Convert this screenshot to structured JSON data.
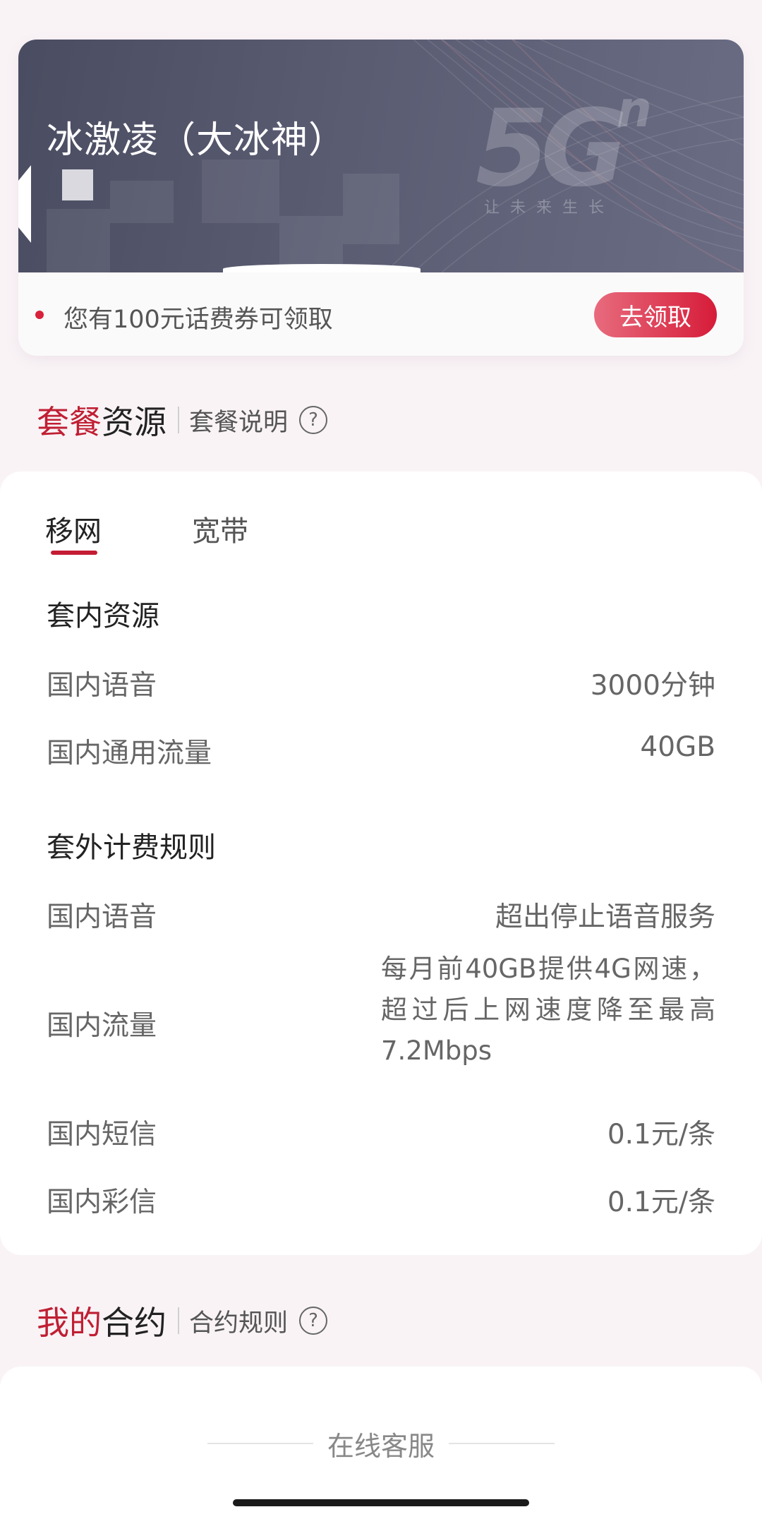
{
  "banner": {
    "user_name": "冰激凌（大冰神）",
    "logo_text": "5G",
    "logo_superscript": "n",
    "logo_slogan": "让未来生长"
  },
  "coupon": {
    "text": "您有100元话费券可领取",
    "button_label": "去领取"
  },
  "package_section": {
    "title_red": "套餐",
    "title_dark": "资源",
    "link_label": "套餐说明",
    "help_symbol": "?"
  },
  "tabs": [
    {
      "label": "移网",
      "active": true
    },
    {
      "label": "宽带",
      "active": false
    }
  ],
  "included": {
    "title": "套内资源",
    "rows": [
      {
        "label": "国内语音",
        "value": "3000分钟"
      },
      {
        "label": "国内通用流量",
        "value": "40GB"
      }
    ]
  },
  "overage": {
    "title": "套外计费规则",
    "rows": [
      {
        "label": "国内语音",
        "value": "超出停止语音服务"
      },
      {
        "label": "国内流量",
        "value": "每月前40GB提供4G网速，超过后上网速度降至最高7.2Mbps"
      },
      {
        "label": "国内短信",
        "value": "0.1元/条"
      },
      {
        "label": "国内彩信",
        "value": "0.1元/条"
      }
    ]
  },
  "contract_section": {
    "title_red": "我的",
    "title_dark": "合约",
    "link_label": "合约规则",
    "help_symbol": "?"
  },
  "online_service": {
    "label": "在线客服"
  },
  "colors": {
    "accent_red": "#c41c34",
    "banner_bg": "#4f5166",
    "page_bg": "#f9f3f6"
  }
}
